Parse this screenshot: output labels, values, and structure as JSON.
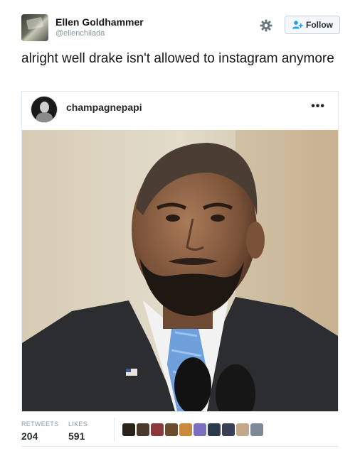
{
  "author": {
    "name": "Ellen Goldhammer",
    "handle": "@ellenchilada"
  },
  "actions": {
    "follow_label": "Follow",
    "settings_icon": "gear-icon",
    "follow_icon": "add-user-icon"
  },
  "tweet": {
    "text": "alright well drake isn't allowed to instagram anymore"
  },
  "embedded_post": {
    "username": "champagnepapi",
    "more_label": "•••"
  },
  "stats": {
    "retweets_label": "RETWEETS",
    "retweets_value": "204",
    "likes_label": "LIKES",
    "likes_value": "591"
  },
  "liker_colors": [
    "#2a2119",
    "#4a3a2c",
    "#8a3a3a",
    "#6a4b2e",
    "#c98a3c",
    "#7b6fbf",
    "#2c3a4e",
    "#3b3e57",
    "#c4a88a",
    "#7c8a9a"
  ],
  "colors": {
    "follow_blue": "#1da1f2",
    "muted_text": "#8899a6"
  }
}
